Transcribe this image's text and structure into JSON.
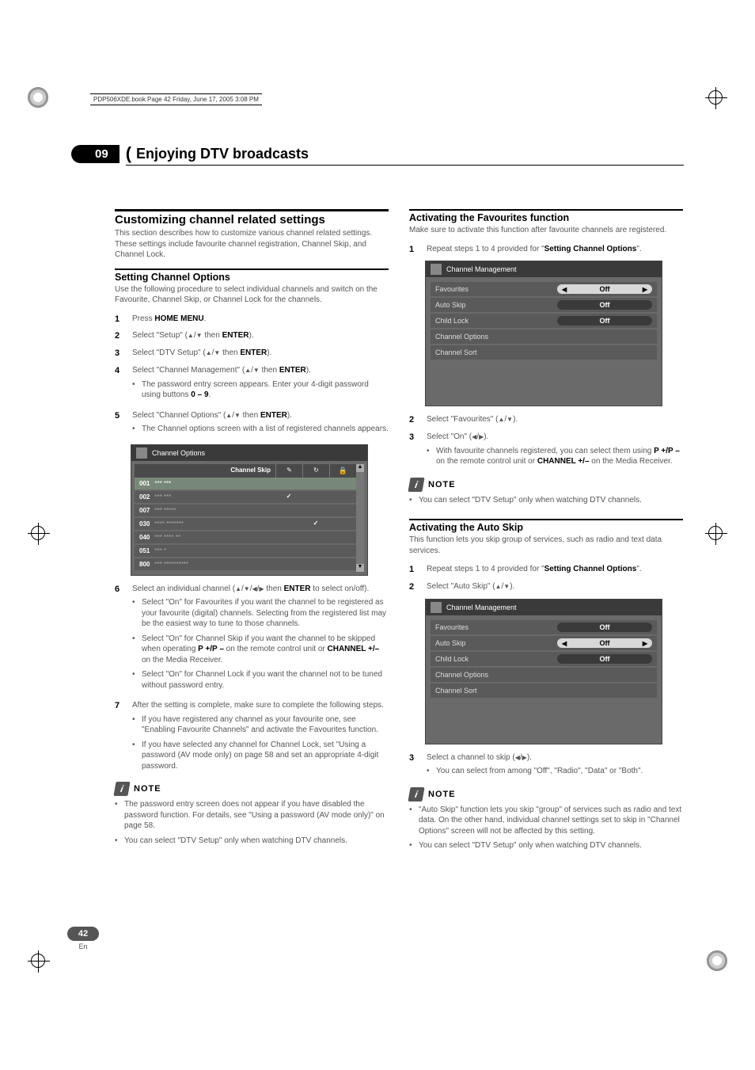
{
  "book_header": "PDP506XDE.book  Page 42  Friday, June 17, 2005  3:08 PM",
  "chapter": {
    "number": "09",
    "title": "Enjoying DTV broadcasts"
  },
  "page": {
    "number": "42",
    "lang": "En"
  },
  "left": {
    "h2": "Customizing channel related settings",
    "intro": "This section describes how to customize various channel related settings. These settings include favourite channel registration, Channel Skip, and Channel Lock.",
    "sco": {
      "h3": "Setting Channel Options",
      "intro": "Use the following procedure to select individual channels and switch on the Favourite, Channel Skip, or Channel Lock for the channels.",
      "steps": {
        "s1_a": "Press ",
        "s1_b": "HOME MENU",
        "s1_c": ".",
        "s2_a": "Select \"Setup\" (",
        "s2_b": " then ",
        "s2_c": "ENTER",
        "s2_d": ").",
        "s3_a": "Select \"DTV Setup\" (",
        "s3_b": " then ",
        "s3_c": "ENTER",
        "s3_d": ").",
        "s4_a": "Select \"Channel Management\" (",
        "s4_b": " then ",
        "s4_c": "ENTER",
        "s4_d": ").",
        "s4_sub": "The password entry screen appears. Enter your 4-digit password using buttons ",
        "s4_sub_k": "0 – 9",
        "s4_sub_end": ".",
        "s5_a": "Select \"Channel Options\" (",
        "s5_b": " then ",
        "s5_c": "ENTER",
        "s5_d": ").",
        "s5_sub": "The Channel options screen with a list of registered channels appears.",
        "s6_a": "Select an individual channel (",
        "s6_b": " then ",
        "s6_c": "ENTER",
        "s6_d": " to select on/off).",
        "s6_sub1": "Select \"On\" for Favourites if you want the channel to be registered as your favourite (digital) channels. Selecting from the registered list may be the easiest way to tune to those channels.",
        "s6_sub2_a": "Select \"On\" for Channel Skip if you want the channel to be skipped when operating ",
        "s6_sub2_k1": "P +/P –",
        "s6_sub2_b": " on the remote control unit or ",
        "s6_sub2_k2": "CHANNEL +/–",
        "s6_sub2_c": " on the Media Receiver.",
        "s6_sub3": "Select \"On\" for Channel Lock if you want the channel not to be tuned without password entry.",
        "s7_a": "After the setting is complete, make sure to complete the following steps.",
        "s7_sub1": "If you have registered any channel as your favourite one, see \"Enabling Favourite Channels\" and activate the Favourites function.",
        "s7_sub2": "If you have selected any channel for Channel Lock, set \"Using a password (AV mode only) on page 58 and set an appropriate 4-digit password."
      },
      "osd": {
        "title": "Channel Options",
        "hcol": "Channel Skip",
        "rows": [
          {
            "num": "001",
            "name": "***  ***"
          },
          {
            "num": "002",
            "name": "***  ***",
            "c2": true
          },
          {
            "num": "007",
            "name": "***  *****"
          },
          {
            "num": "030",
            "name": "****  *******",
            "c3": true
          },
          {
            "num": "040",
            "name": "***  ****  **"
          },
          {
            "num": "051",
            "name": "*** *"
          },
          {
            "num": "800",
            "name": "***  **********"
          }
        ]
      },
      "note_label": "NOTE",
      "notes": [
        "The password entry screen does not appear if you have disabled the password function. For details, see \"Using a password (AV mode only)\" on page 58.",
        "You can select \"DTV Setup\" only when watching DTV channels."
      ]
    }
  },
  "right": {
    "fav": {
      "h3": "Activating the Favourites function",
      "intro": "Make sure to activate this function after favourite channels are registered.",
      "s1_a": "Repeat steps 1 to 4 provided for \"",
      "s1_b": "Setting Channel Options",
      "s1_c": "\".",
      "s2": "Select \"Favourites\" (",
      "s2_end": ").",
      "s3": "Select \"On\" (",
      "s3_end": ").",
      "s3_sub_a": "With favourite channels registered, you can select them using ",
      "s3_sub_k1": "P +/P –",
      "s3_sub_b": " on the remote control unit or ",
      "s3_sub_k2": "CHANNEL +/–",
      "s3_sub_c": " on the Media Receiver.",
      "osd": {
        "title": "Channel Management",
        "rows": [
          {
            "label": "Favourites",
            "val": "Off",
            "sel": true
          },
          {
            "label": "Auto Skip",
            "val": "Off"
          },
          {
            "label": "Child Lock",
            "val": "Off"
          },
          {
            "label": "Channel Options"
          },
          {
            "label": "Channel Sort"
          }
        ]
      },
      "note_label": "NOTE",
      "note1": "You can select \"DTV Setup\" only when watching DTV channels."
    },
    "auto": {
      "h3": "Activating the Auto Skip",
      "intro": "This function lets you skip group of services, such as radio and text data services.",
      "s1_a": "Repeat steps 1 to 4 provided for \"",
      "s1_b": "Setting Channel Options",
      "s1_c": "\".",
      "s2": "Select \"Auto Skip\" (",
      "s2_end": ").",
      "s3": "Select a channel to skip (",
      "s3_end": ").",
      "s3_sub": "You can select from among \"Off\", \"Radio\", \"Data\" or \"Both\".",
      "osd": {
        "title": "Channel Management",
        "rows": [
          {
            "label": "Favourites",
            "val": "Off"
          },
          {
            "label": "Auto Skip",
            "val": "Off",
            "sel": true
          },
          {
            "label": "Child Lock",
            "val": "Off"
          },
          {
            "label": "Channel Options"
          },
          {
            "label": "Channel Sort"
          }
        ]
      },
      "note_label": "NOTE",
      "notes": [
        "\"Auto Skip\" function lets you skip \"group\" of services such as radio and text data. On the other hand, individual channel settings set to skip in \"Channel Options\" screen will not be affected by this setting.",
        "You can select \"DTV Setup\" only when watching DTV channels."
      ]
    }
  }
}
